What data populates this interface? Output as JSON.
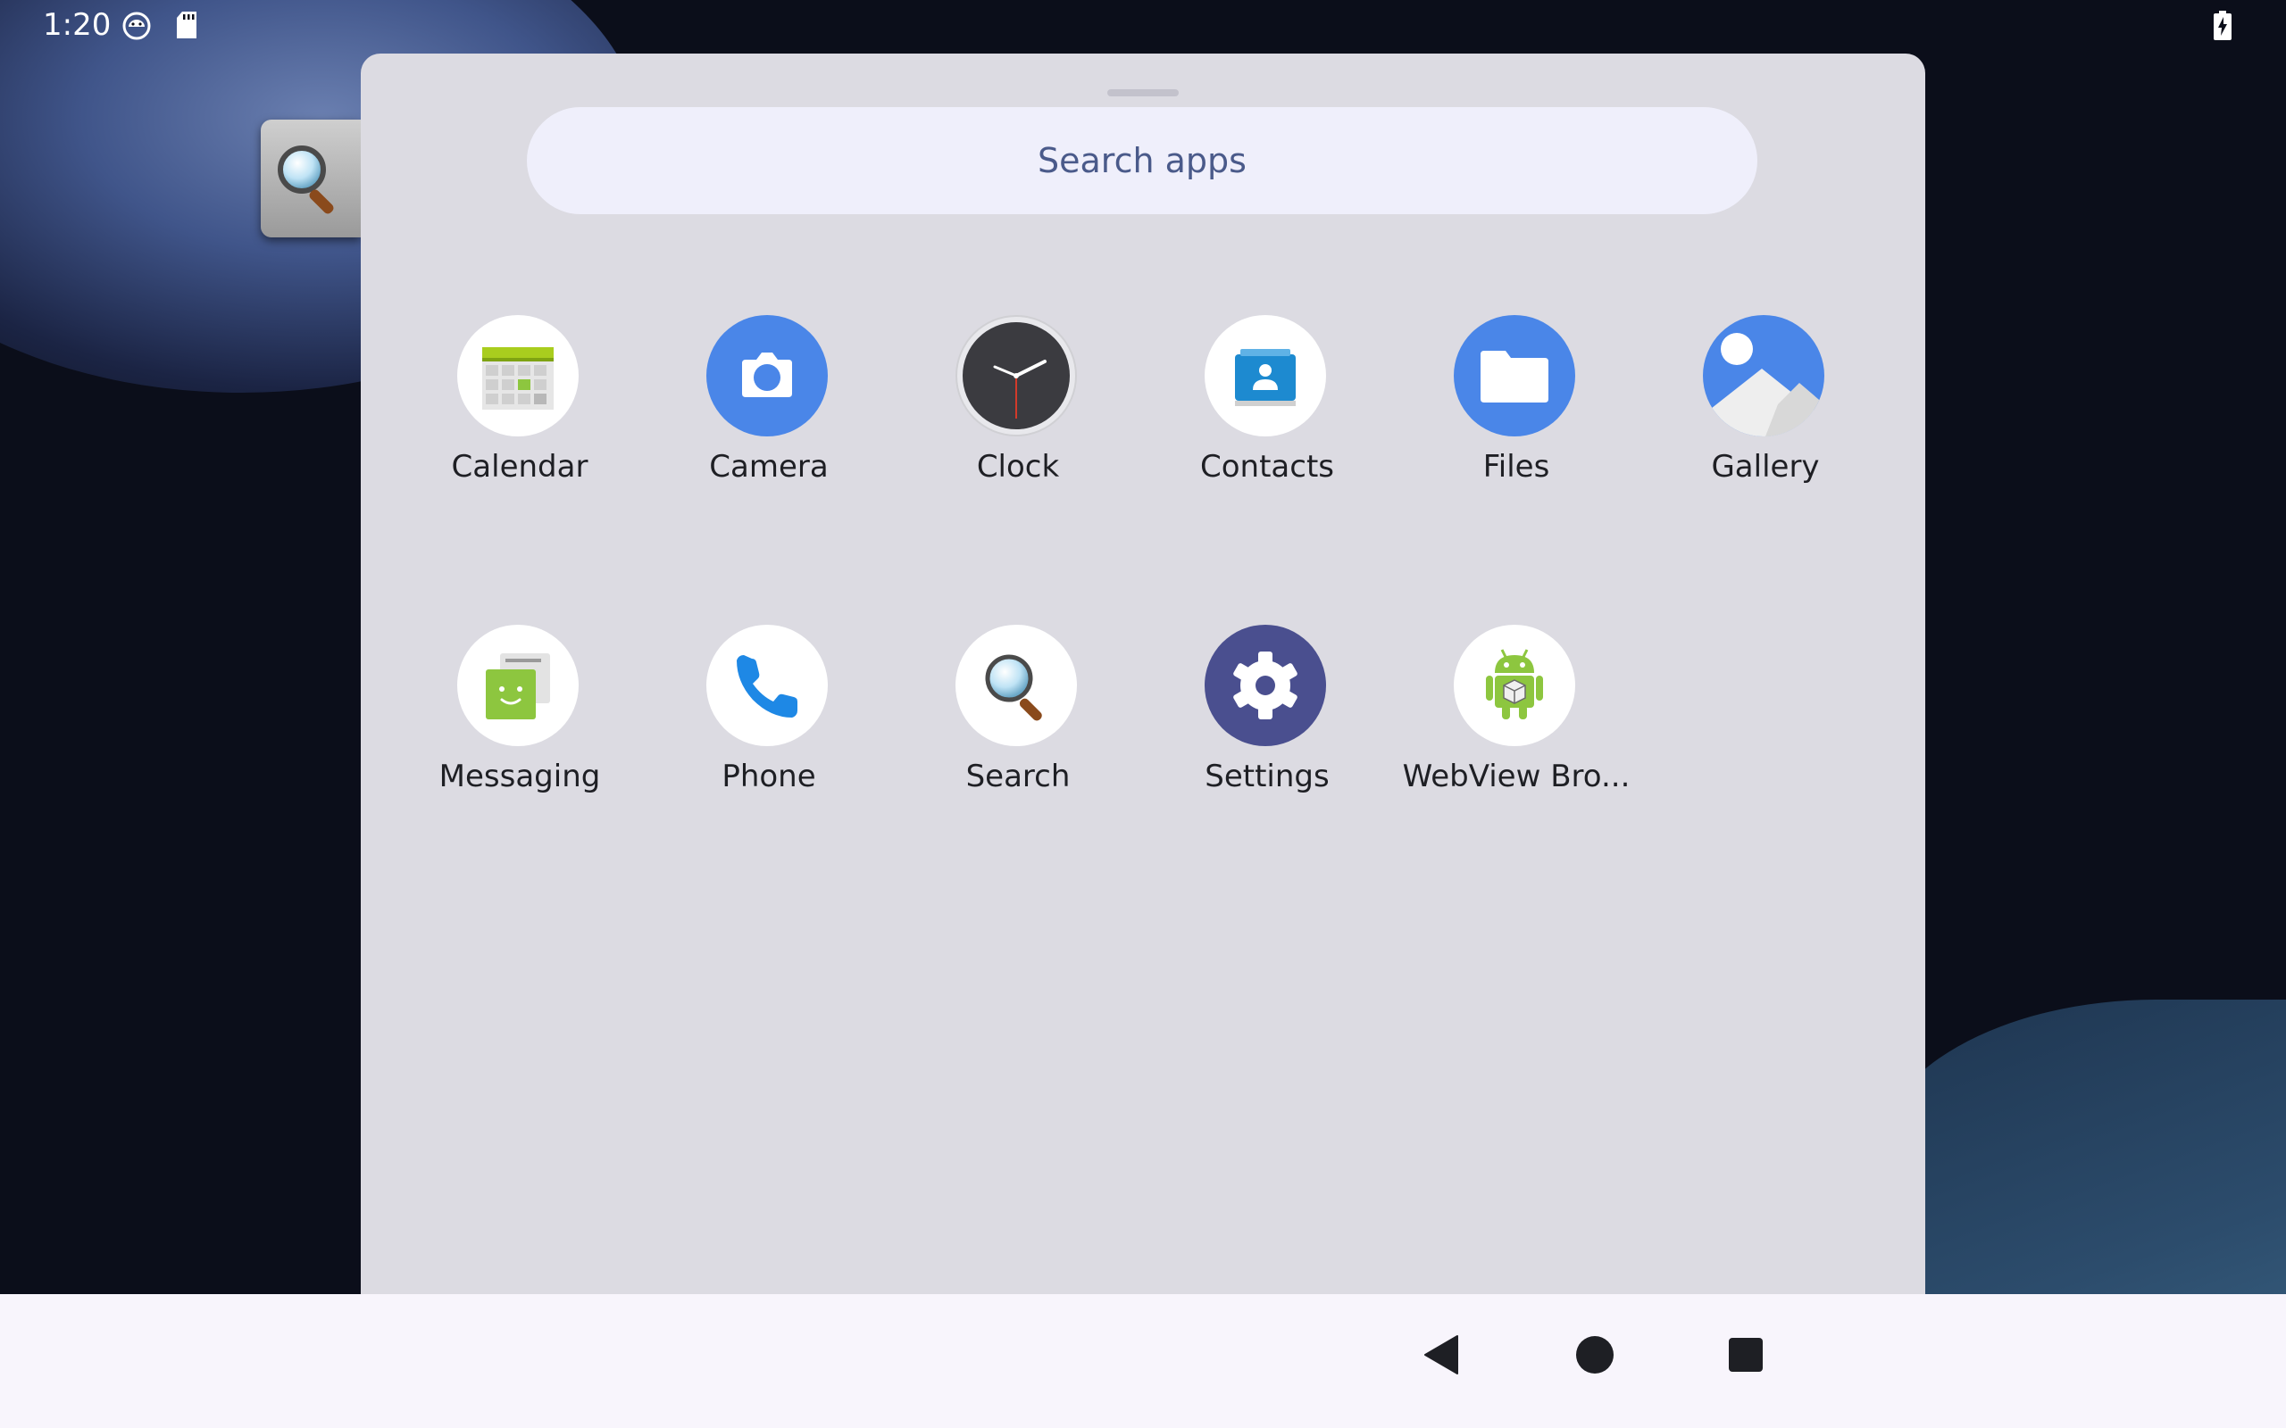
{
  "status_bar": {
    "time": "1:20",
    "icons": [
      "android-debug-icon",
      "sd-card-icon",
      "battery-charging-icon"
    ]
  },
  "side_widget": {
    "icon": "magnifier-icon"
  },
  "drawer": {
    "search": {
      "placeholder": "Search apps"
    },
    "apps": [
      {
        "label": "Calendar",
        "icon": "calendar-icon"
      },
      {
        "label": "Camera",
        "icon": "camera-icon"
      },
      {
        "label": "Clock",
        "icon": "clock-icon"
      },
      {
        "label": "Contacts",
        "icon": "contacts-icon"
      },
      {
        "label": "Files",
        "icon": "files-icon"
      },
      {
        "label": "Gallery",
        "icon": "gallery-icon"
      },
      {
        "label": "Messaging",
        "icon": "messaging-icon"
      },
      {
        "label": "Phone",
        "icon": "phone-icon"
      },
      {
        "label": "Search",
        "icon": "search-icon"
      },
      {
        "label": "Settings",
        "icon": "settings-icon"
      },
      {
        "label": "WebView Bro...",
        "icon": "webview-android-icon"
      }
    ]
  },
  "nav_bar": {
    "buttons": [
      "back-icon",
      "home-icon",
      "recents-icon"
    ]
  },
  "colors": {
    "drawer_bg": "#dcdbe2",
    "search_bg": "#efeffb",
    "search_text": "#4a5a8a",
    "nav_bg": "#f8f5fc",
    "accent_blue": "#4a86e8"
  }
}
